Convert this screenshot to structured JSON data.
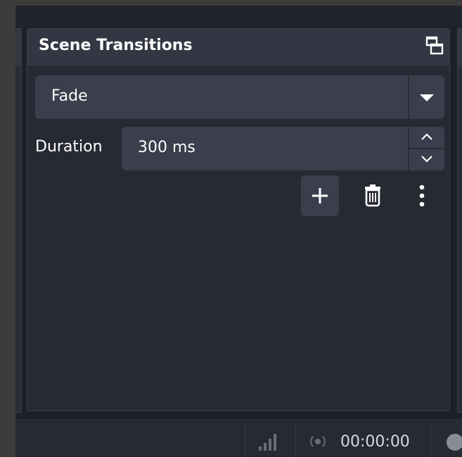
{
  "dock": {
    "title": "Scene Transitions",
    "undock_icon": "undock-icon"
  },
  "transition": {
    "selected": "Fade"
  },
  "duration": {
    "label": "Duration",
    "value": "300 ms"
  },
  "toolbar": {
    "add_icon": "plus-icon",
    "remove_icon": "trash-icon",
    "menu_icon": "kebab-menu-icon"
  },
  "statusbar": {
    "network_icon": "network-signal-icon",
    "stream_icon": "streaming-icon",
    "stream_time": "00:00:00",
    "record_icon": "record-icon"
  },
  "colors": {
    "window_bg": "#1e2028",
    "dock_bg": "#272a33",
    "header_bg": "#333643",
    "control_bg": "#3b3e4c",
    "text": "#ffffff"
  }
}
